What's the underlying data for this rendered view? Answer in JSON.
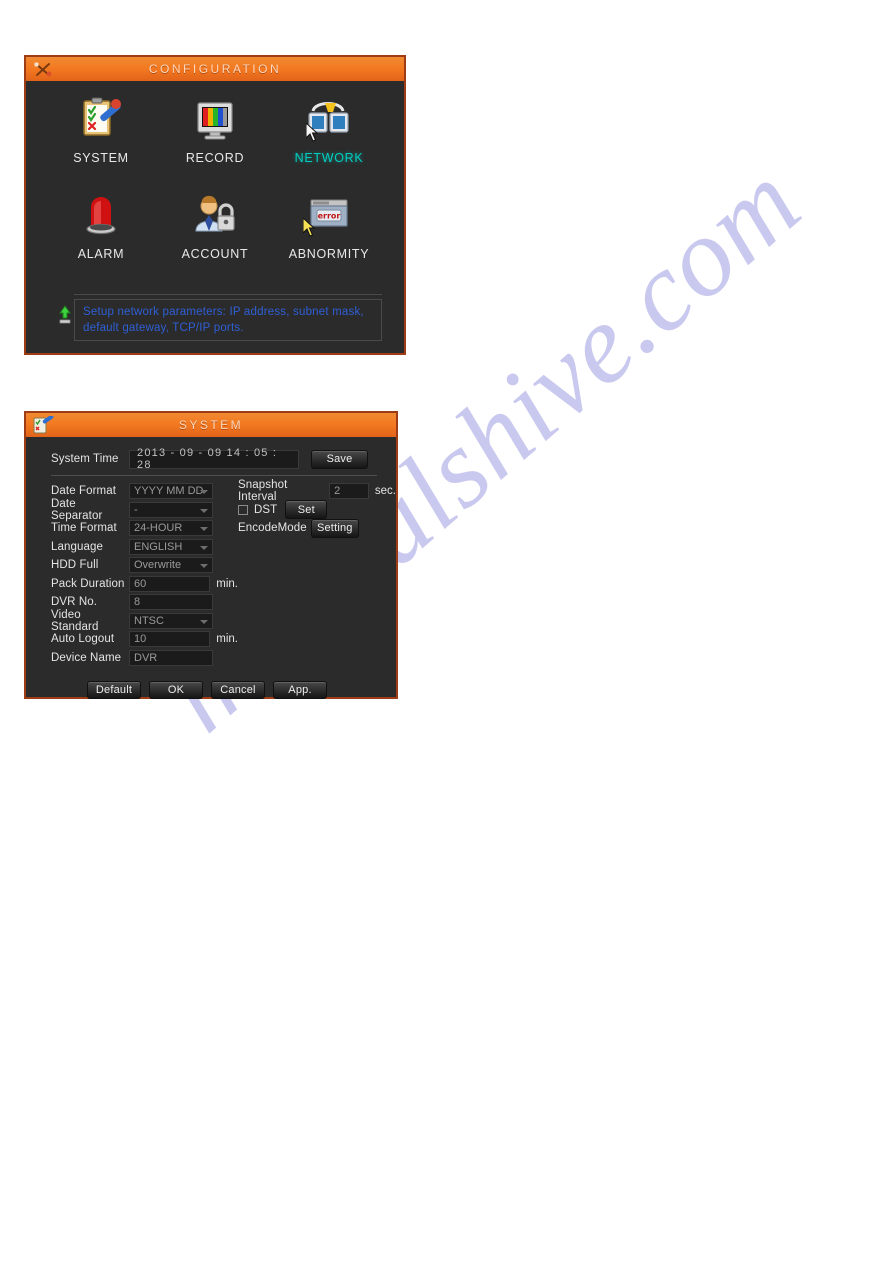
{
  "watermark": {
    "text": "manualshive.com"
  },
  "configuration_window": {
    "title": "CONFIGURATION",
    "title_icon": "tools-icon",
    "menu_items": [
      {
        "label": "SYSTEM",
        "icon": "clipboard-checklist-icon",
        "selected": false
      },
      {
        "label": "RECORD",
        "icon": "monitor-colorbars-icon",
        "selected": false
      },
      {
        "label": "NETWORK",
        "icon": "network-computers-icon",
        "selected": true
      },
      {
        "label": "ALARM",
        "icon": "siren-icon",
        "selected": false
      },
      {
        "label": "ACCOUNT",
        "icon": "user-padlock-icon",
        "selected": false
      },
      {
        "label": "ABNORMITY",
        "icon": "error-dialog-icon",
        "selected": false
      }
    ],
    "tip": {
      "icon": "lightbulb-tip-icon",
      "line1": "Setup network parameters: IP address, subnet mask,",
      "line2": "default gateway, TCP/IP ports."
    },
    "selected_accent_color": "#00cfc0",
    "border_color": "#9e3c16",
    "titlebar_color": "#f37a21"
  },
  "system_window": {
    "title": "SYSTEM",
    "title_icon": "clipboard-pencil-icon",
    "system_time": {
      "label": "System Time",
      "value": "2013 - 09 - 09   14 : 05 : 28",
      "save_label": "Save"
    },
    "left_fields": [
      {
        "label": "Date Format",
        "value": "YYYY MM DD",
        "type": "combo",
        "unit": ""
      },
      {
        "label": "Date Separator",
        "value": "-",
        "type": "combo",
        "unit": ""
      },
      {
        "label": "Time Format",
        "value": "24-HOUR",
        "type": "combo",
        "unit": ""
      },
      {
        "label": "Language",
        "value": "ENGLISH",
        "type": "combo",
        "unit": ""
      },
      {
        "label": "HDD Full",
        "value": "Overwrite",
        "type": "combo",
        "unit": ""
      },
      {
        "label": "Pack Duration",
        "value": "60",
        "type": "text",
        "unit": "min."
      },
      {
        "label": "DVR No.",
        "value": "8",
        "type": "text",
        "unit": ""
      },
      {
        "label": "Video Standard",
        "value": "NTSC",
        "type": "combo",
        "unit": ""
      },
      {
        "label": "Auto Logout",
        "value": "10",
        "type": "text",
        "unit": "min."
      },
      {
        "label": "Device Name",
        "value": "DVR",
        "type": "text",
        "unit": ""
      }
    ],
    "right_panel": {
      "snapshot_label": "Snapshot Interval",
      "snapshot_value": "2",
      "snapshot_unit": "sec.",
      "dst_label": "DST",
      "dst_checked": false,
      "dst_set_label": "Set",
      "encode_label": "EncodeMode",
      "encode_setting_label": "Setting"
    },
    "buttons": [
      {
        "label": "Default"
      },
      {
        "label": "OK"
      },
      {
        "label": "Cancel"
      },
      {
        "label": "App."
      }
    ]
  }
}
